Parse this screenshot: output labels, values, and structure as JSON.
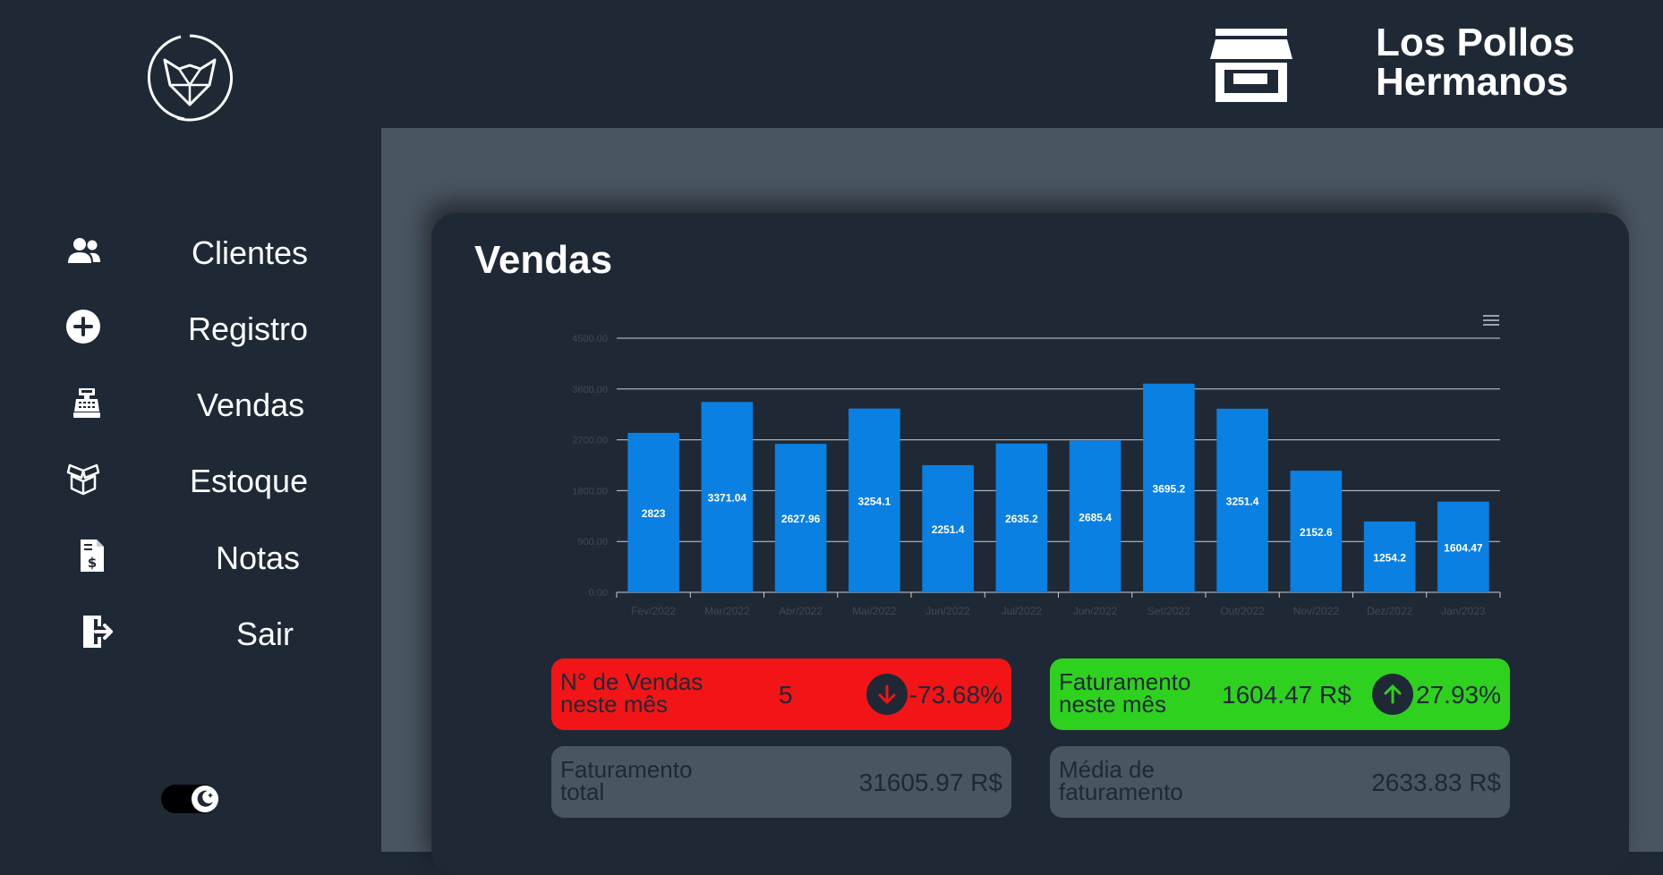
{
  "brand": {
    "name_line1": "Los Pollos",
    "name_line2": "Hermanos"
  },
  "sidebar": {
    "items": [
      {
        "label": "Clientes",
        "icon": "users-icon"
      },
      {
        "label": "Registro",
        "icon": "plus-circle-icon"
      },
      {
        "label": "Vendas",
        "icon": "cash-register-icon"
      },
      {
        "label": "Estoque",
        "icon": "boxes-icon"
      },
      {
        "label": "Notas",
        "icon": "invoice-icon"
      },
      {
        "label": "Sair",
        "icon": "logout-icon"
      }
    ],
    "theme_toggle_icon": "moon-icon"
  },
  "page": {
    "title": "Vendas"
  },
  "chart_data": {
    "type": "bar",
    "categories": [
      "Fev/2022",
      "Mar/2022",
      "Abr/2022",
      "Mai/2022",
      "Jun/2022",
      "Jul/2022",
      "Jun/2022",
      "Set/2022",
      "Out/2022",
      "Nov/2022",
      "Dez/2022",
      "Jan/2023"
    ],
    "values": [
      2823,
      3371.04,
      2627.96,
      3254.1,
      2251.4,
      2635.2,
      2685.4,
      3695.2,
      3251.4,
      2152.6,
      1254.2,
      1604.47
    ],
    "value_labels": [
      "2823",
      "3371.04",
      "2627.96",
      "3254.1",
      "2251.4",
      "2635.2",
      "2685.4",
      "3695.2",
      "3251.4",
      "2152.6",
      "1254.2",
      "1604.47"
    ],
    "y_ticks": [
      "0.00",
      "900.00",
      "1800.00",
      "2700.00",
      "3600.00",
      "4500.00"
    ],
    "ylim": [
      0,
      4500
    ],
    "grid": true,
    "bar_color": "#0a80e3"
  },
  "kpis": {
    "sales_count": {
      "label": "N° de Vendas neste mês",
      "value": "5",
      "change": "-73.68%",
      "direction_icon": "arrow-down-icon"
    },
    "revenue_month": {
      "label": "Faturamento neste mês",
      "value": "1604.47 R$",
      "change": "27.93%",
      "direction_icon": "arrow-up-icon"
    },
    "revenue_total": {
      "label": "Faturamento total",
      "value": "31605.97 R$"
    },
    "revenue_avg": {
      "label": "Média de faturamento",
      "value": "2633.83 R$"
    }
  },
  "colors": {
    "background": "#1f2936",
    "content": "#4a5562",
    "negative": "#f21416",
    "positive": "#2fd11f"
  }
}
